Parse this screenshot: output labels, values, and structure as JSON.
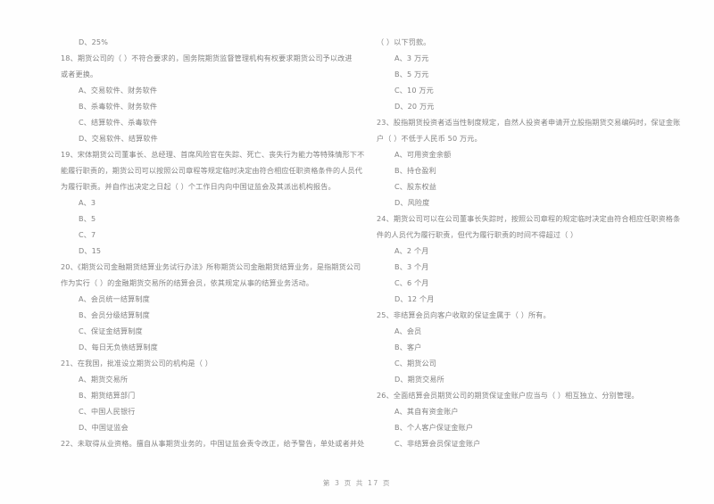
{
  "document": {
    "background_color": "#fefefe",
    "text_color": "#707070",
    "footer": "第 3 页  共 17 页"
  },
  "left_column": {
    "dangling_option": "D、25%",
    "questions": [
      {
        "number": "18",
        "stem_lines": [
          "18、期货公司的（      ）不符合要求的，国务院期货监督管理机构有权要求期货公司予以改进",
          "或者更换。"
        ],
        "options": [
          "A、交易软件、财务软件",
          "B、杀毒软件、财务软件",
          "C、结算软件、杀毒软件",
          "D、交易软件、结算软件"
        ]
      },
      {
        "number": "19",
        "stem_lines": [
          "19、宋体期货公司董事长、总经理、首席风险官在失踪、死亡、丧失行为能力等特殊情形下不",
          "能履行职责的，期货公司可以按照公司章程等规定临时决定由符合相应任职资格条件的人员代",
          "为履行职责。并自作出决定之日起（      ）个工作日内向中国证监会及其派出机构报告。"
        ],
        "options": [
          "A、3",
          "B、5",
          "C、7",
          "D、15"
        ]
      },
      {
        "number": "20",
        "stem_lines": [
          "20、《期货公司金融期货结算业务试行办法》所称期货公司金融期货结算业务，是指期货公司",
          "作为实行（      ）的金融期货交易所的结算会员，依其规定从事的结算业务活动。"
        ],
        "options": [
          "A、会员统一结算制度",
          "B、会员分级结算制度",
          "C、保证金结算制度",
          "D、每日无负债结算制度"
        ]
      },
      {
        "number": "21",
        "stem_lines": [
          "21、在我国，批准设立期货公司的机构是（      ）"
        ],
        "options": [
          "A、期货交易所",
          "B、期货结算部门",
          "C、中国人民银行",
          "D、中国证监会"
        ]
      },
      {
        "number": "22",
        "stem_lines": [
          "22、未取得从业资格。擅自从事期货业务的，中国证监会责令改正，给予警告，单处或者并处"
        ],
        "options": []
      }
    ]
  },
  "right_column": {
    "continuation_lines": [
      "（      ）以下罚款。"
    ],
    "continuation_options": [
      "A、3 万元",
      "B、5 万元",
      "C、10 万元",
      "D、20 万元"
    ],
    "questions": [
      {
        "number": "23",
        "stem_lines": [
          "23、股指期货投资者适当性制度规定，自然人投资者申请开立股指期货交易编码时，保证金账",
          "户（      ）不低于人民币 50 万元。"
        ],
        "options": [
          "A、可用资金余额",
          "B、持仓盈利",
          "C、股东权益",
          "D、风险度"
        ]
      },
      {
        "number": "24",
        "stem_lines": [
          "24、期货公司可以在公司董事长失踪时，按照公司章程的规定临时决定由符合相应任职资格条",
          "件的人员代为履行职责，但代为履行职责的时间不得超过（      ）"
        ],
        "options": [
          "A、2 个月",
          "B、3 个月",
          "C、6 个月",
          "D、12 个月"
        ]
      },
      {
        "number": "25",
        "stem_lines": [
          "25、非结算会员向客户收取的保证金属于（      ）所有。"
        ],
        "options": [
          "A、会员",
          "B、客户",
          "C、期货公司",
          "D、期货交易所"
        ]
      },
      {
        "number": "26",
        "stem_lines": [
          "26、全面结算会员期货公司的期货保证金账户应当与（      ）相互独立、分别管理。"
        ],
        "options": [
          "A、其自有资金账户",
          "B、个人客户保证金账户",
          "C、非结算会员保证金账户"
        ]
      }
    ]
  }
}
